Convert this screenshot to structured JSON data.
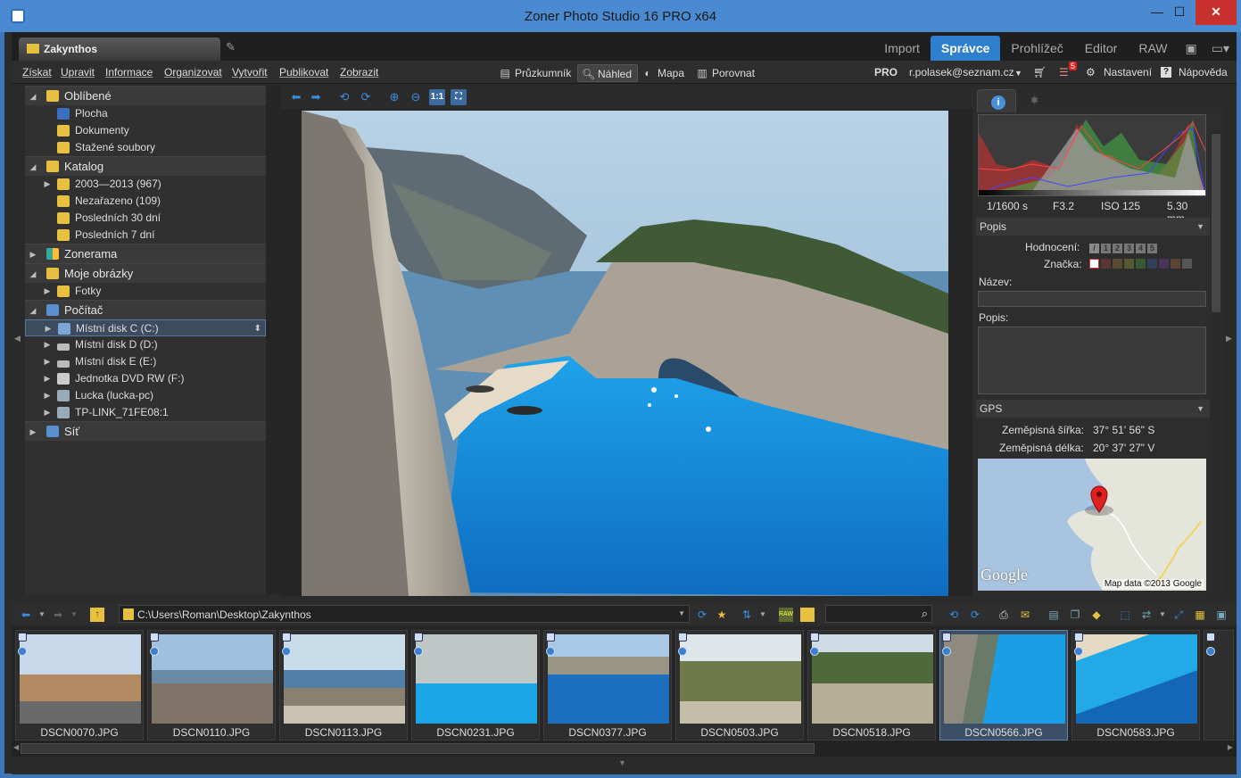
{
  "window": {
    "title": "Zoner Photo Studio 16 PRO x64"
  },
  "doc_tab": {
    "label": "Zakynthos"
  },
  "mode_tabs": [
    {
      "label": "Import"
    },
    {
      "label": "Správce"
    },
    {
      "label": "Prohlížeč"
    },
    {
      "label": "Editor"
    },
    {
      "label": "RAW"
    }
  ],
  "menu": [
    "Získat",
    "Upravit",
    "Informace",
    "Organizovat",
    "Vytvořit",
    "Publikovat",
    "Zobrazit"
  ],
  "views": [
    "Průzkumník",
    "Náhled",
    "Mapa",
    "Porovnat"
  ],
  "right_menu": {
    "pro": "PRO",
    "account": "r.polasek@seznam.cz",
    "badge": "5",
    "settings": "Nastavení",
    "help": "Nápověda"
  },
  "tree": {
    "favorites": {
      "label": "Oblíbené",
      "items": [
        "Plocha",
        "Dokumenty",
        "Stažené soubory"
      ]
    },
    "catalog": {
      "label": "Katalog",
      "items": [
        "2003—2013 (967)",
        "Nezařazeno (109)",
        "Posledních 30 dní",
        "Posledních 7 dní"
      ]
    },
    "zonerama": {
      "label": "Zonerama"
    },
    "pictures": {
      "label": "Moje obrázky",
      "items": [
        "Fotky"
      ]
    },
    "computer": {
      "label": "Počítač",
      "items": [
        "Místní disk C (C:)",
        "Místní disk D (D:)",
        "Místní disk E (E:)",
        "Jednotka DVD RW (F:)",
        "Lucka (lucka-pc)",
        "TP-LINK_71FE08:1"
      ]
    },
    "network": {
      "label": "Síť"
    }
  },
  "exif": {
    "shutter": "1/1600 s",
    "aperture": "F3.2",
    "iso": "ISO 125",
    "focal": "5.30 mm"
  },
  "panel": {
    "popis_section": "Popis",
    "rating_label": "Hodnocení:",
    "rating_values": [
      "1",
      "2",
      "3",
      "4",
      "5"
    ],
    "mark_label": "Značka:",
    "name_label": "Název:",
    "desc_label": "Popis:",
    "gps_section": "GPS",
    "lat_label": "Zeměpisná šířka:",
    "lat_value": "37° 51' 56\" S",
    "lon_label": "Zeměpisná délka:",
    "lon_value": "20° 37' 27\" V",
    "map_logo": "Google",
    "map_credit": "Map data ©2013 Google"
  },
  "colors": {
    "accent": "#2f7fcf",
    "titlebar": "#4a8ad0",
    "close": "#c7302d"
  },
  "path": "C:\\Users\\Roman\\Desktop\\Zakynthos",
  "thumbnails": [
    "DSCN0070.JPG",
    "DSCN0110.JPG",
    "DSCN0113.JPG",
    "DSCN0231.JPG",
    "DSCN0377.JPG",
    "DSCN0503.JPG",
    "DSCN0518.JPG",
    "DSCN0566.JPG",
    "DSCN0583.JPG"
  ],
  "selected_thumbnail": "DSCN0566.JPG"
}
